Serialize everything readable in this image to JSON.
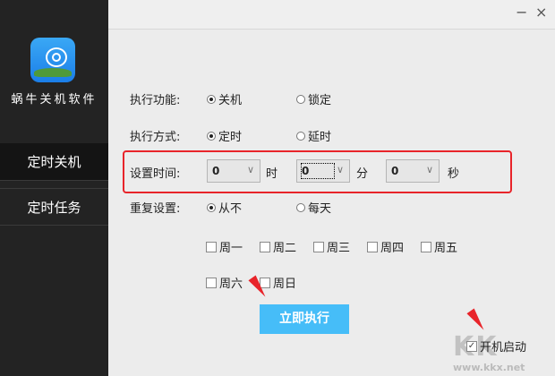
{
  "app": {
    "name": "蜗牛关机软件"
  },
  "sidebar": {
    "items": [
      {
        "label": "定时关机"
      },
      {
        "label": "定时任务"
      }
    ]
  },
  "window": {
    "minimize": "−",
    "close": "×"
  },
  "form": {
    "action_label": "执行功能:",
    "action_options": [
      "关机",
      "锁定"
    ],
    "action_selected": "关机",
    "mode_label": "执行方式:",
    "mode_options": [
      "定时",
      "延时"
    ],
    "mode_selected": "定时",
    "time_label": "设置时间:",
    "hour": "0",
    "hour_unit": "时",
    "minute": "0",
    "minute_unit": "分",
    "second": "0",
    "second_unit": "秒",
    "repeat_label": "重复设置:",
    "repeat_options": [
      "从不",
      "每天"
    ],
    "repeat_selected": "从不",
    "weekdays": [
      "周一",
      "周二",
      "周三",
      "周四",
      "周五",
      "周六",
      "周日"
    ]
  },
  "execute_button": "立即执行",
  "autostart": {
    "label": "开机启动",
    "checked": true
  },
  "watermark": {
    "logo": "KK下载",
    "url": "www.kkx.net"
  },
  "colors": {
    "accent": "#46bdf8",
    "highlight": "#e8242a",
    "sidebar": "#232323"
  }
}
